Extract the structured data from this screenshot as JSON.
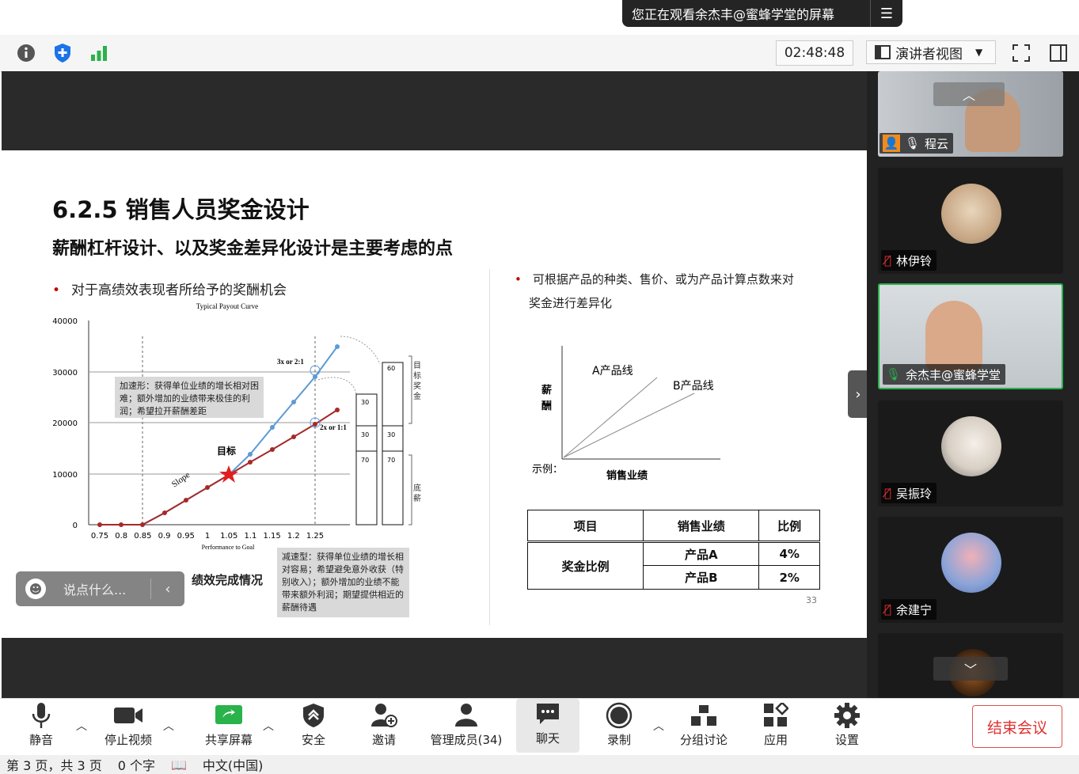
{
  "top_notice": {
    "text": "您正在观看余杰丰@蜜蜂学堂的屏幕"
  },
  "toolbar": {
    "timer": "02:48:48",
    "view_label": "演讲者视图"
  },
  "slide": {
    "title": "6.2.5 销售人员奖金设计",
    "subtitle": "薪酬杠杆设计、以及奖金差异化设计是主要考虑的点",
    "bullet_left": "对于高绩效表现者所给予的奖酬机会",
    "bullet_right_line1": "可根据产品的种类、售价、或为产品计算点数来对",
    "bullet_right_line2": "奖金进行差异化",
    "page_number": "33",
    "chart_left": {
      "title": "Typical Payout Curve",
      "x_axis_caption": "Performance to Goal",
      "x_label_cn": "绩效完成情况",
      "y_ticks": [
        "40000",
        "30000",
        "20000",
        "10000",
        "0"
      ],
      "x_ticks": [
        "0.75",
        "0.8",
        "0.85",
        "0.9",
        "0.95",
        "1",
        "1.05",
        "1.1",
        "1.15",
        "1.2",
        "1.25"
      ],
      "target_label": "目标",
      "slope_label": "Slope",
      "ratio_high": "3x or 2:1",
      "ratio_low": "2x or 1:1",
      "note_accelerate": "加速形：获得单位业绩的增长相对困难；额外增加的业绩带来极佳的利润；希望拉开薪酬差距",
      "note_decelerate": "减速型：获得单位业绩的增长相对容易；希望避免意外收获（特别收入）；额外增加的业绩不能带来额外利润；期望提供相近的薪酬待遇",
      "bar_labels": {
        "target_bonus": "目标奖金",
        "base_pay": "底薪"
      },
      "stack_values": {
        "col1_top": "30",
        "col1_mid": "30",
        "col1_bottom": "70",
        "col2_top": "60",
        "col2_mid": "30",
        "col2_bottom": "70"
      }
    },
    "chart_right": {
      "y_label": "薪酬",
      "x_label": "销售业绩",
      "line_a": "A产品线",
      "line_b": "B产品线",
      "example": "示例："
    },
    "table": {
      "headers": [
        "项目",
        "销售业绩",
        "比例"
      ],
      "row_label": "奖金比例",
      "rows": [
        [
          "产品A",
          "4%"
        ],
        [
          "产品B",
          "2%"
        ]
      ]
    }
  },
  "comment_box": {
    "placeholder": "说点什么..."
  },
  "participants": [
    {
      "name": "程云"
    },
    {
      "name": "林伊铃"
    },
    {
      "name": "余杰丰@蜜蜂学堂"
    },
    {
      "name": "吴振玲"
    },
    {
      "name": "余建宁"
    }
  ],
  "bottom_bar": {
    "mute": "静音",
    "stop_video": "停止视频",
    "share_screen": "共享屏幕",
    "security": "安全",
    "invite": "邀请",
    "manage_members": "管理成员(34)",
    "chat": "聊天",
    "record": "录制",
    "breakout": "分组讨论",
    "apps": "应用",
    "settings": "设置",
    "end_meeting": "结束会议"
  },
  "status_bar": {
    "pages": "第 3 页，共 3 页",
    "words": "0 个字",
    "language": "中文(中国)"
  },
  "colors": {
    "accent_green": "#2ab24b",
    "end_red": "#e03030",
    "curve_blue": "#5b9bd5",
    "curve_red": "#a52a2a"
  }
}
